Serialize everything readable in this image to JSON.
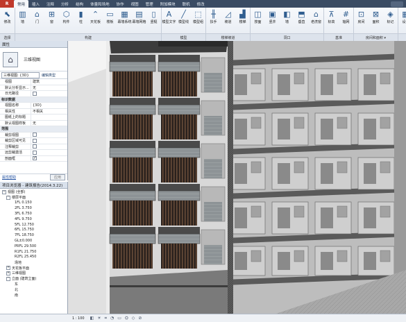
{
  "app_button": "R",
  "tabs": [
    "常用",
    "插入",
    "注释",
    "分析",
    "结构",
    "体量和场地",
    "协作",
    "视图",
    "管理",
    "附加模块",
    "联机",
    "修改"
  ],
  "active_tab_index": 0,
  "ribbon": {
    "groups": [
      {
        "label": "选择",
        "tools": [
          {
            "icon": "cursor-icon",
            "glyph": "⬉",
            "label": "修改"
          }
        ]
      },
      {
        "label": "构建",
        "tools": [
          {
            "icon": "wall-icon",
            "glyph": "▥",
            "label": "墙"
          },
          {
            "icon": "door-icon",
            "glyph": "⌂",
            "label": "门"
          },
          {
            "icon": "window-icon",
            "glyph": "⊞",
            "label": "窗"
          },
          {
            "icon": "component-icon",
            "glyph": "⬡",
            "label": "构件"
          },
          {
            "icon": "column-icon",
            "glyph": "▮",
            "label": "柱"
          },
          {
            "icon": "roof-icon",
            "glyph": "⌃",
            "label": "天花板"
          },
          {
            "icon": "floor-icon",
            "glyph": "▭",
            "label": "楼板"
          },
          {
            "icon": "curtain-system-icon",
            "glyph": "▦",
            "label": "幕墙系统"
          },
          {
            "icon": "curtain-grid-icon",
            "glyph": "▤",
            "label": "幕墙网格"
          },
          {
            "icon": "mullion-icon",
            "glyph": "▯",
            "label": "竖梃"
          }
        ]
      },
      {
        "label": "模型",
        "tools": [
          {
            "icon": "model-text-icon",
            "glyph": "A",
            "label": "模型文字"
          },
          {
            "icon": "model-line-icon",
            "glyph": "╱",
            "label": "模型线"
          },
          {
            "icon": "model-group-icon",
            "glyph": "⬚",
            "label": "模型组"
          }
        ]
      },
      {
        "label": "楼梯坡道",
        "tools": [
          {
            "icon": "railing-icon",
            "glyph": "╫",
            "label": "扶手"
          },
          {
            "icon": "ramp-icon",
            "glyph": "◿",
            "label": "坡道"
          },
          {
            "icon": "stair-icon",
            "glyph": "▟",
            "label": "楼梯"
          }
        ]
      },
      {
        "label": "洞口",
        "tools": [
          {
            "icon": "by-face-icon",
            "glyph": "◫",
            "label": "按面"
          },
          {
            "icon": "shaft-icon",
            "glyph": "▣",
            "label": "竖井"
          },
          {
            "icon": "wall-opening-icon",
            "glyph": "◧",
            "label": "墙"
          },
          {
            "icon": "vertical-icon",
            "glyph": "⬒",
            "label": "垂直"
          },
          {
            "icon": "dormer-icon",
            "glyph": "⌂",
            "label": "老虎窗"
          }
        ]
      },
      {
        "label": "基准",
        "tools": [
          {
            "icon": "level-icon",
            "glyph": "⊼",
            "label": "标高"
          },
          {
            "icon": "grid-icon",
            "glyph": "#",
            "label": "轴网"
          }
        ]
      },
      {
        "label": "房间和面积 ▾",
        "tools": [
          {
            "icon": "room-icon",
            "glyph": "⊡",
            "label": "房间"
          },
          {
            "icon": "area-icon",
            "glyph": "⊠",
            "label": "面积"
          },
          {
            "icon": "tag-icon",
            "glyph": "◈",
            "label": "标记"
          }
        ]
      },
      {
        "label": "工作平",
        "tools": [
          {
            "icon": "set-icon",
            "glyph": "▦",
            "label": "设置"
          },
          {
            "icon": "show-icon",
            "glyph": "▩",
            "label": "显示"
          }
        ]
      }
    ]
  },
  "properties": {
    "header": "属性",
    "type_name": "三维视图",
    "selector": "三维视图: {3D}",
    "edit_type": "编辑类型",
    "rows": [
      {
        "k": "视图",
        "v": "建筑",
        "sec": false
      },
      {
        "k": "默认分析显示...",
        "v": "无",
        "sec": false
      },
      {
        "k": "日光路径",
        "v": "",
        "cb": "off",
        "sec": false
      },
      {
        "k": "标识数据",
        "v": "",
        "sec": true
      },
      {
        "k": "视图名称",
        "v": "{3D}",
        "sec": false
      },
      {
        "k": "相关性",
        "v": "不相关",
        "sec": false
      },
      {
        "k": "图纸上的标题",
        "v": "",
        "sec": false
      },
      {
        "k": "默认视图样板",
        "v": "无",
        "sec": false
      },
      {
        "k": "范围",
        "v": "",
        "sec": true
      },
      {
        "k": "裁剪视图",
        "v": "",
        "cb": "off",
        "sec": false
      },
      {
        "k": "裁剪区域可见",
        "v": "",
        "cb": "off",
        "sec": false
      },
      {
        "k": "注释裁剪",
        "v": "",
        "cb": "off",
        "sec": false
      },
      {
        "k": "远剪裁激活",
        "v": "",
        "cb": "off",
        "sec": false
      },
      {
        "k": "剖面框",
        "v": "",
        "cb": "on",
        "sec": false
      }
    ],
    "help_link": "属性帮助",
    "apply_button": "应用"
  },
  "browser": {
    "header": "项目浏览器 - 建筑报告(2014.3.22)",
    "items": [
      {
        "t": "视图 (全部)",
        "lvl": 0,
        "ex": "−"
      },
      {
        "t": "楼层平面",
        "lvl": 1,
        "ex": "−"
      },
      {
        "t": "1FL 0.150",
        "lvl": 3,
        "ex": ""
      },
      {
        "t": "2FL 3.750",
        "lvl": 3,
        "ex": ""
      },
      {
        "t": "3FL 6.750",
        "lvl": 3,
        "ex": ""
      },
      {
        "t": "4FL 9.750",
        "lvl": 3,
        "ex": ""
      },
      {
        "t": "5FL 12.750",
        "lvl": 3,
        "ex": ""
      },
      {
        "t": "6FL 15.750",
        "lvl": 3,
        "ex": ""
      },
      {
        "t": "7FL 18.750",
        "lvl": 3,
        "ex": ""
      },
      {
        "t": "GL±0.000",
        "lvl": 3,
        "ex": ""
      },
      {
        "t": "PRFL 29.500",
        "lvl": 3,
        "ex": ""
      },
      {
        "t": "R1FL 21.750",
        "lvl": 3,
        "ex": ""
      },
      {
        "t": "R2FL 25.450",
        "lvl": 3,
        "ex": ""
      },
      {
        "t": "场地",
        "lvl": 3,
        "ex": ""
      },
      {
        "t": "天花板平面",
        "lvl": 1,
        "ex": "+"
      },
      {
        "t": "三维视图",
        "lvl": 1,
        "ex": "+"
      },
      {
        "t": "立面 (建筑立面)",
        "lvl": 1,
        "ex": "−"
      },
      {
        "t": "东",
        "lvl": 3,
        "ex": ""
      },
      {
        "t": "北",
        "lvl": 3,
        "ex": ""
      },
      {
        "t": "南",
        "lvl": 3,
        "ex": ""
      }
    ]
  },
  "status": {
    "scale": "1 : 100",
    "icons": [
      "◧",
      "☀",
      "⌗",
      "◔",
      "▭",
      "⛭",
      "◇",
      "⊘"
    ]
  }
}
